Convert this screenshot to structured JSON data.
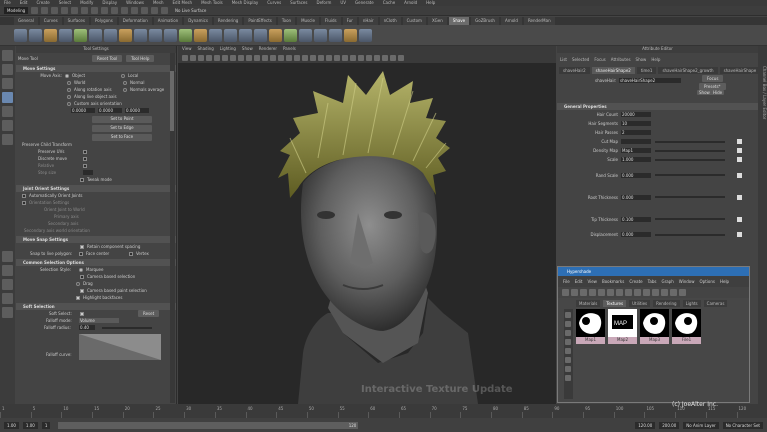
{
  "app": {
    "menus": [
      "File",
      "Edit",
      "Create",
      "Select",
      "Modify",
      "Display",
      "Windows",
      "Mesh",
      "Edit Mesh",
      "Mesh Tools",
      "Mesh Display",
      "Curves",
      "Surfaces",
      "Deform",
      "UV",
      "Generate",
      "Cache",
      "Arnold",
      "Help"
    ],
    "mode": "Modeling",
    "live_surface": "No Live Surface"
  },
  "shelf": {
    "tabs": [
      "General",
      "Curves",
      "Surfaces",
      "Polygons",
      "Deformation",
      "Animation",
      "Dynamics",
      "Rendering",
      "PaintEffects",
      "Toon",
      "Muscle",
      "Fluids",
      "Fur",
      "nHair",
      "nCloth",
      "Custom",
      "XGen",
      "Shave",
      "GoZBrush",
      "Arnold",
      "RenderMan"
    ],
    "active_tab": "Shave",
    "icon_count": 24
  },
  "tool_settings": {
    "title": "Tool Settings",
    "tool": "Move Tool",
    "reset_label": "Reset Tool",
    "help_label": "Tool Help",
    "move_settings": {
      "header": "Move Settings",
      "axis_label": "Move Axis:",
      "axis_options": [
        "Object",
        "Local",
        "World",
        "Normal",
        "Along rotation axis",
        "Along live object axis",
        "Custom axis orientation",
        "Normals average"
      ],
      "values": [
        "0.0000",
        "0.0000",
        "0.0000"
      ],
      "set_buttons": [
        "Set to Point",
        "Set to Edge",
        "Set to Face"
      ],
      "preserve_label": "Preserve Child Transform",
      "checks": [
        "Preserve UVs",
        "Discrete move",
        "Relative",
        "Step size"
      ],
      "tweak_label": "Tweak mode"
    },
    "joint_orient": {
      "header": "Joint Orient Settings",
      "auto": "Automatically Orient Joints",
      "orientation": "Orientation Settings",
      "dims": [
        "Orient Joint to World",
        "Primary axis",
        "Secondary axis",
        "Secondary axis world orientation"
      ]
    },
    "snap": {
      "header": "Move Snap Settings",
      "retain": "Retain component spacing",
      "snap_label": "Snap to live polygon:",
      "face_center": "Face center",
      "vertex": "Vertex"
    },
    "common": {
      "header": "Common Selection Options",
      "style_label": "Selection Style:",
      "marquee": "Marquee",
      "camera_based": "Camera based selection",
      "drag": "Drag",
      "camera_paint": "Camera based paint selection",
      "highlight": "Highlight backfaces"
    },
    "soft": {
      "header": "Soft Selection",
      "select_label": "Soft Select:",
      "reset": "Reset",
      "falloff_mode_label": "Falloff mode:",
      "falloff_mode": "Volume",
      "radius_label": "Falloff radius:",
      "radius": "0.40",
      "curve_label": "Falloff curve:"
    }
  },
  "viewport": {
    "menus": [
      "View",
      "Shading",
      "Lighting",
      "Show",
      "Renderer",
      "Panels"
    ],
    "overlay": "Interactive Texture Update",
    "hair_color": "#8b8a3a"
  },
  "attribute_editor": {
    "title": "Attribute Editor",
    "menus": [
      "List",
      "Selected",
      "Focus",
      "Attributes",
      "Show",
      "Help"
    ],
    "tabs": [
      "shaveHair2",
      "shaveHairShape2",
      "time1",
      "shaveHairShape2_growth",
      "shaveHairShape"
    ],
    "node_label": "shaveHair:",
    "node_value": "shaveHairShape2",
    "focus": "Focus",
    "presets": "Presets*",
    "show": "Show",
    "hide": "Hide",
    "section": "General Properties",
    "rows": [
      {
        "label": "Hair Count",
        "value": "20000"
      },
      {
        "label": "Hair Segments",
        "value": "10"
      },
      {
        "label": "Hair Passes",
        "value": "2"
      },
      {
        "label": "Cut Map",
        "value": ""
      },
      {
        "label": "Density Map",
        "value": "Map1"
      },
      {
        "label": "Scale",
        "value": "1.000"
      },
      {
        "label": "Rand Scale",
        "value": "0.000"
      },
      {
        "label": "Root Thickness",
        "value": "0.000"
      },
      {
        "label": "Tip Thickness",
        "value": "0.100"
      },
      {
        "label": "Displacement",
        "value": "0.000"
      }
    ]
  },
  "hypershade": {
    "title": "Hypershade",
    "menus": [
      "File",
      "Edit",
      "View",
      "Bookmarks",
      "Create",
      "Tabs",
      "Graph",
      "Window",
      "Options",
      "Help"
    ],
    "tabs": [
      "Materials",
      "Textures",
      "Utilities",
      "Rendering",
      "Lights",
      "Cameras"
    ],
    "active_tab": "Textures",
    "swatches": [
      "Map1",
      "Map2",
      "Map3",
      "File1"
    ]
  },
  "timeline": {
    "ticks": [
      "1",
      "5",
      "10",
      "15",
      "20",
      "25",
      "30",
      "35",
      "40",
      "45",
      "50",
      "55",
      "60",
      "65",
      "70",
      "75",
      "80",
      "85",
      "90",
      "95",
      "100",
      "105",
      "110",
      "115",
      "120"
    ],
    "start": "1.00",
    "range_start": "1.00",
    "range_end": "120.00",
    "end": "200.00",
    "current": "1",
    "range_label": "120",
    "anim_layer": "No Anim Layer",
    "char_set": "No Character Set"
  },
  "copyright": "(c) JoeAlter Inc.",
  "side_label": "Channel Box / Layer Editor"
}
